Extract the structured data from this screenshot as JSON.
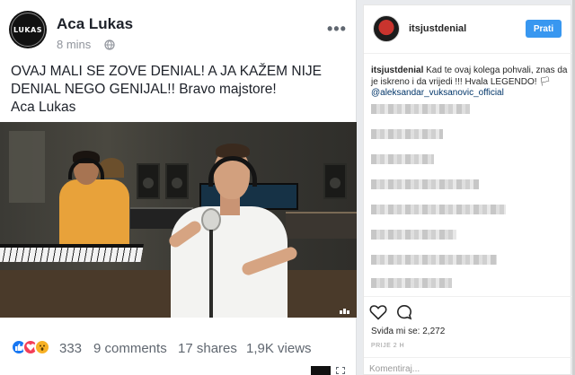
{
  "facebook_post": {
    "author": "Aca Lukas",
    "avatar_text": "LUKAS",
    "time": "8 mins",
    "privacy_icon": "globe-icon",
    "more_icon": "more-horizontal-icon",
    "text_lines": [
      "OVAJ MALI SE ZOVE DENIAL! A JA KAŽEM NIJE",
      "DENIAL NEGO GENIJAL!! Bravo majstore!",
      "Aca Lukas"
    ],
    "reactions": [
      "like",
      "love",
      "wow"
    ],
    "reaction_count": "333",
    "comments": "9 comments",
    "shares": "17 shares",
    "views": "1,9K views",
    "video_icon": "fullscreen-icon"
  },
  "instagram": {
    "username": "itsjustdenial",
    "follow_label": "Prati",
    "caption_user": "itsjustdenial",
    "caption_text": " Kad te ovaj kolega pohvali, znas da je iskreno i da vrijedi !!! Hvala LEGENDO! 🏳",
    "mention": "@aleksandar_vuksanovic_official",
    "likes": "Sviđa mi se: 2,272",
    "date": "PRIJE 2 H",
    "comment_placeholder": "Komentiraj...",
    "like_icon": "heart-outline-icon",
    "comment_icon": "comment-bubble-icon"
  },
  "colors": {
    "fb_text": "#1d2129",
    "fb_meta": "#606770",
    "ig_follow": "#3897f0",
    "ig_link": "#003569"
  }
}
